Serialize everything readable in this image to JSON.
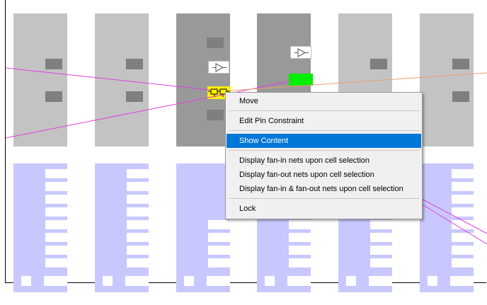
{
  "menu": {
    "items": [
      {
        "label": "Move"
      },
      {
        "label": "Edit Pin Constraint"
      },
      {
        "label": "Show Content",
        "selected": true
      },
      {
        "label": "Display fan-in nets upon cell selection"
      },
      {
        "label": "Display fan-out nets upon cell selection"
      },
      {
        "label": "Display fan-in & fan-out nets upon cell selection"
      },
      {
        "label": "Lock"
      }
    ]
  },
  "colors": {
    "grey_column": "#c3c3c3",
    "dark_column": "#999999",
    "blue_column": "#c8c8ff",
    "net_magenta": "#e040e0",
    "net_orange": "#e8a070",
    "highlight_cell": "#ffee00",
    "green_cell": "#00ee00",
    "selection": "#0078d7"
  },
  "icons": [
    "buffer-icon",
    "buffer-icon",
    "flip-flop-icon"
  ]
}
